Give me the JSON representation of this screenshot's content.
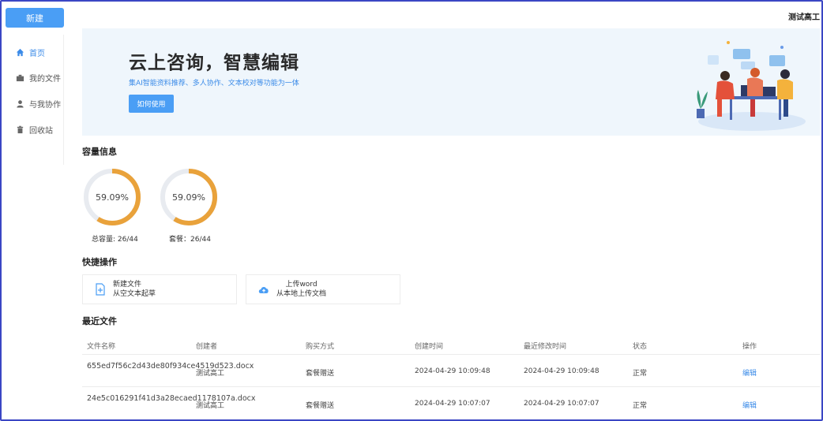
{
  "sidebar": {
    "new_label": "新建",
    "items": [
      {
        "label": "首页",
        "icon": "home-icon",
        "active": true
      },
      {
        "label": "我的文件",
        "icon": "folder-icon",
        "active": false
      },
      {
        "label": "与我协作",
        "icon": "user-icon",
        "active": false
      },
      {
        "label": "回收站",
        "icon": "trash-icon",
        "active": false
      }
    ]
  },
  "header": {
    "user_name": "测试高工"
  },
  "banner": {
    "title": "云上咨询，智慧编辑",
    "subtitle": "集AI智能资料推荐、多人协作、文本校对等功能为一体",
    "button_label": "如何使用"
  },
  "capacity": {
    "title": "容量信息",
    "gauges": [
      {
        "percent_text": "59.09%",
        "fraction": 0.5909,
        "label": "总容量: 26/44"
      },
      {
        "percent_text": "59.09%",
        "fraction": 0.5909,
        "label": "套餐：26/44"
      }
    ],
    "colors": {
      "track": "#e8ebf0",
      "fill": "#e9a23b"
    }
  },
  "quick_actions": {
    "title": "快捷操作",
    "items": [
      {
        "line1": "新建文件",
        "line2": "从空文本起草",
        "icon": "new-file-icon"
      },
      {
        "line1": "上传word",
        "line2": "从本地上传文档",
        "icon": "cloud-upload-icon"
      }
    ]
  },
  "recent": {
    "title": "最近文件",
    "columns": [
      "文件名称",
      "创建者",
      "购买方式",
      "创建时间",
      "最近修改时间",
      "状态",
      "操作"
    ],
    "rows": [
      {
        "name": "655ed7f56c2d43de80f934ce4519d523.docx",
        "creator": "测试高工",
        "purchase": "套餐赠送",
        "created": "2024-04-29 10:09:48",
        "modified": "2024-04-29 10:09:48",
        "status": "正常",
        "action": "编辑"
      },
      {
        "name": "24e5c016291f41d3a28ecaed1178107a.docx",
        "creator": "测试高工",
        "purchase": "套餐赠送",
        "created": "2024-04-29 10:07:07",
        "modified": "2024-04-29 10:07:07",
        "status": "正常",
        "action": "编辑"
      }
    ]
  },
  "colors": {
    "accent": "#4a9ef5",
    "link": "#3b8be8",
    "banner_bg": "#eff6fc"
  }
}
